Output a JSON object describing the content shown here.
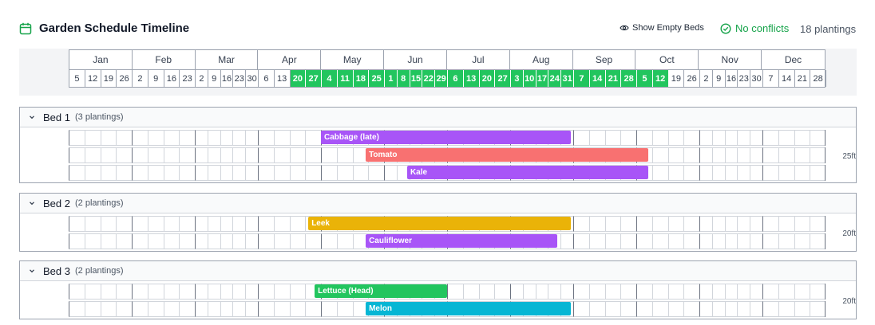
{
  "header": {
    "title": "Garden Schedule Timeline",
    "title_icon": "calendar-icon",
    "show_empty_label": "Show Empty Beds",
    "show_empty_icon": "eye-icon",
    "conflicts_label": "No conflicts",
    "conflicts_icon": "check-circle-icon",
    "plantings_count": "18 plantings"
  },
  "colors": {
    "accent_green": "#22c55e",
    "status_green": "#16a34a",
    "purple": "#a855f7",
    "red": "#f87171",
    "amber": "#eab308",
    "green": "#22c55e",
    "cyan": "#06b6d4"
  },
  "months": [
    "Jan",
    "Feb",
    "Mar",
    "Apr",
    "May",
    "Jun",
    "Jul",
    "Aug",
    "Sep",
    "Oct",
    "Nov",
    "Dec"
  ],
  "weeks": [
    [
      "5",
      "12",
      "19",
      "26"
    ],
    [
      "2",
      "9",
      "16",
      "23"
    ],
    [
      "2",
      "9",
      "16",
      "23",
      "30"
    ],
    [
      "6",
      "13",
      "20",
      "27"
    ],
    [
      "4",
      "11",
      "18",
      "25"
    ],
    [
      "1",
      "8",
      "15",
      "22",
      "29"
    ],
    [
      "6",
      "13",
      "20",
      "27"
    ],
    [
      "3",
      "10",
      "17",
      "24",
      "31"
    ],
    [
      "7",
      "14",
      "21",
      "28"
    ],
    [
      "5",
      "12",
      "19",
      "26"
    ],
    [
      "2",
      "9",
      "16",
      "23",
      "30"
    ],
    [
      "7",
      "14",
      "21",
      "28"
    ]
  ],
  "active_weeks": {
    "from": "Apr 20",
    "to": "Oct 12"
  },
  "beds": [
    {
      "name": "Bed 1",
      "count": "(3 plantings)",
      "size": "25ft",
      "plantings": [
        {
          "name": "Cabbage (late)",
          "color": "purple",
          "start": "May 1",
          "end": "Aug 31"
        },
        {
          "name": "Tomato",
          "color": "red",
          "start": "May 23",
          "end": "Oct 7"
        },
        {
          "name": "Kale",
          "color": "purple",
          "start": "Jun 12",
          "end": "Oct 7"
        }
      ]
    },
    {
      "name": "Bed 2",
      "count": "(2 plantings)",
      "size": "20ft",
      "plantings": [
        {
          "name": "Leek",
          "color": "amber",
          "start": "Apr 25",
          "end": "Aug 31"
        },
        {
          "name": "Cauliflower",
          "color": "purple",
          "start": "May 23",
          "end": "Aug 24"
        }
      ]
    },
    {
      "name": "Bed 3",
      "count": "(2 plantings)",
      "size": "20ft",
      "plantings": [
        {
          "name": "Lettuce (Head)",
          "color": "green",
          "start": "Apr 28",
          "end": "Jul 1"
        },
        {
          "name": "Melon",
          "color": "cyan",
          "start": "May 23",
          "end": "Aug 31"
        }
      ]
    }
  ]
}
